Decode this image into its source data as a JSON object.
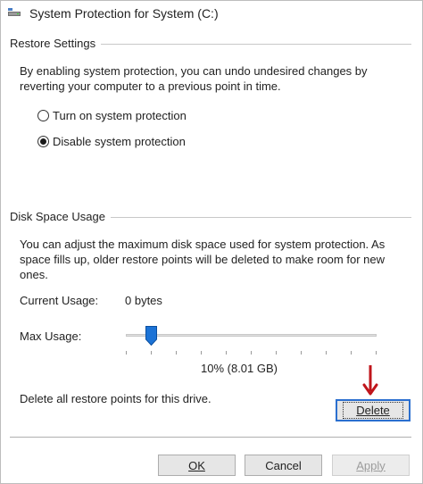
{
  "window": {
    "title": "System Protection for System (C:)",
    "icon": "drive-protection-icon"
  },
  "restore_settings": {
    "heading": "Restore Settings",
    "description_line1": "By enabling system protection, you can undo undesired changes by",
    "description_line2": "reverting your computer to a previous point in time.",
    "options": [
      {
        "label": "Turn on system protection",
        "checked": false
      },
      {
        "label": "Disable system protection",
        "checked": true
      }
    ]
  },
  "disk_space": {
    "heading": "Disk Space Usage",
    "description_line1": "You can adjust the maximum disk space used for system protection. As",
    "description_line2": "space fills up, older restore points will be deleted to make room for new",
    "description_line3": "ones.",
    "current_usage_label": "Current Usage:",
    "current_usage_value": "0 bytes",
    "max_usage_label": "Max Usage:",
    "max_usage_percent": 10,
    "max_usage_text": "10% (8.01 GB)",
    "delete_text": "Delete all restore points for this drive.",
    "delete_label": "Delete"
  },
  "buttons": {
    "ok": "OK",
    "cancel": "Cancel",
    "apply": "Apply"
  },
  "colors": {
    "accent": "#2b6fcf",
    "arrow": "#c0151b"
  }
}
